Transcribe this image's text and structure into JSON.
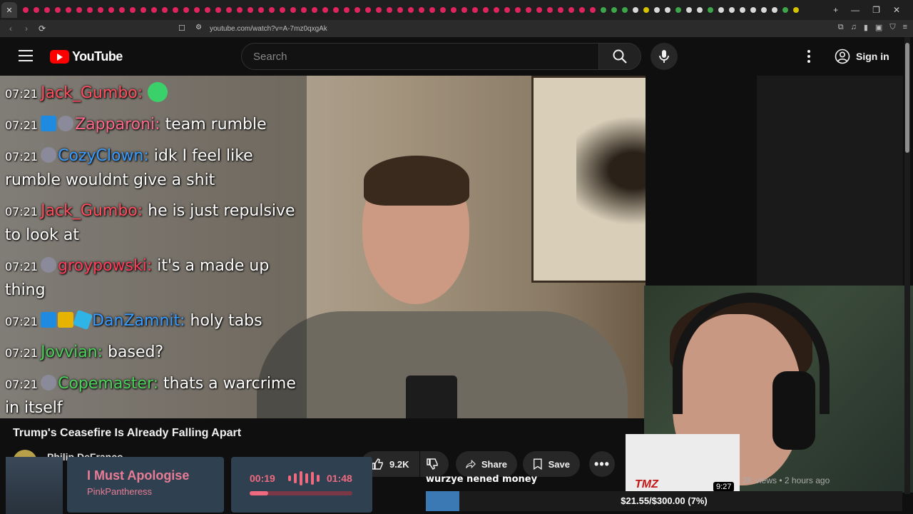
{
  "browser": {
    "close_glyph": "✕",
    "new_tab_glyph": "+",
    "url": "youtube.com/watch?v=A-7mz0qxgAk",
    "window_controls": [
      "—",
      "❐",
      "✕"
    ]
  },
  "header": {
    "logo_text": "YouTube",
    "search_placeholder": "Search",
    "sign_in_label": "Sign in"
  },
  "chat": [
    {
      "time": "07:21",
      "user": "Jack_Gumbo",
      "color": "#ff4d5e",
      "badges": [],
      "message": "",
      "emote": true
    },
    {
      "time": "07:21",
      "user": "Zapparoni",
      "color": "#ff6a8a",
      "badges": [
        "blue",
        "gray"
      ],
      "message": "team rumble"
    },
    {
      "time": "07:21",
      "user": "CozyClown",
      "color": "#3a9cff",
      "badges": [
        "gray"
      ],
      "message": "idk I feel like rumble wouldnt give a shit"
    },
    {
      "time": "07:21",
      "user": "Jack_Gumbo",
      "color": "#ff4d5e",
      "badges": [],
      "message": "he is just repulsive to look at"
    },
    {
      "time": "07:21",
      "user": "groypowski",
      "color": "#ff3d5a",
      "badges": [
        "gray"
      ],
      "message": "it's a made up thing"
    },
    {
      "time": "07:21",
      "user": "DanZamnit",
      "color": "#3a9cff",
      "badges": [
        "blue",
        "gold",
        "cyan"
      ],
      "message": "holy tabs"
    },
    {
      "time": "07:21",
      "user": "Jovvian",
      "color": "#4bd25a",
      "badges": [],
      "message": "based?"
    },
    {
      "time": "07:21",
      "user": "Copemaster",
      "color": "#4bd25a",
      "badges": [
        "gray"
      ],
      "message": "thats a warcrime in itself"
    }
  ],
  "video": {
    "title": "Trump's Ceasefire Is Already Falling Apart",
    "channel": "Philip DeFranco",
    "likes": "9.2K",
    "share_label": "Share",
    "save_label": "Save"
  },
  "recommended": {
    "duration": "9:27",
    "meta": "2K views • 2 hours ago",
    "thumb_brand": "TMZ"
  },
  "music": {
    "title": "I Must Apologise",
    "artist": "PinkPantheress",
    "current": "00:19",
    "total": "01:48",
    "progress": 0.18
  },
  "alert": {
    "message": "wurzye nened money"
  },
  "donation": {
    "text": "$21.55/$300.00 (7%)",
    "progress": 0.07
  },
  "colors": {
    "yt_red": "#ff0000",
    "music_accent": "#f06a7f",
    "donation_fill": "#3a79b4"
  }
}
